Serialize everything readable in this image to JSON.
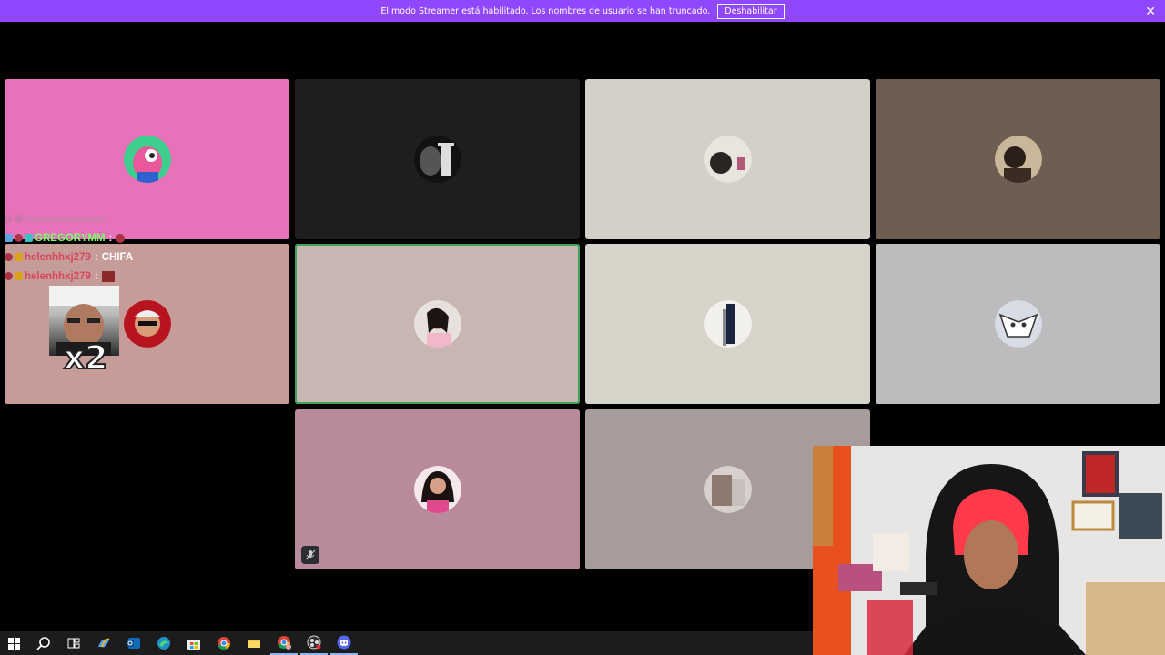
{
  "banner": {
    "message": "El modo Streamer está habilitado. Los nombres de usuario se han truncado.",
    "button_label": "Deshabilitar",
    "close_symbol": "✕",
    "color": "#9146ff"
  },
  "tiles": [
    {
      "bg": "#e872b9"
    },
    {
      "bg": "#1e1e20"
    },
    {
      "bg": "#d4d0c8"
    },
    {
      "bg": "#6d5e51"
    },
    {
      "bg": "#c69c98"
    },
    {
      "bg": "#c8b6b5"
    },
    {
      "bg": "#d6d3c9"
    },
    {
      "bg": "#bcbcbe"
    },
    {
      "bg": "#b98a9b"
    },
    {
      "bg": "#a89b9b"
    }
  ],
  "chat": {
    "lines": [
      {
        "user": "GREGORYMM",
        "sep": ":",
        "message": "",
        "user_color": "#7cfc6b"
      },
      {
        "user": "helenhhxj279",
        "sep": ":",
        "message": "CHIFA",
        "user_color": "#d9455f"
      },
      {
        "user": "helenhhxj279",
        "sep": ":",
        "message": "",
        "user_color": "#d9455f"
      }
    ],
    "multiplier": "x2"
  },
  "taskbar": {
    "items": [
      "windows-start",
      "search",
      "task-view",
      "copilot",
      "outlook",
      "edge",
      "store",
      "chrome",
      "file-explorer",
      "chrome-profile",
      "obs",
      "discord"
    ]
  },
  "colors": {
    "speaking_outline": "#3ba55c",
    "taskbar": "#1c1c1c"
  }
}
